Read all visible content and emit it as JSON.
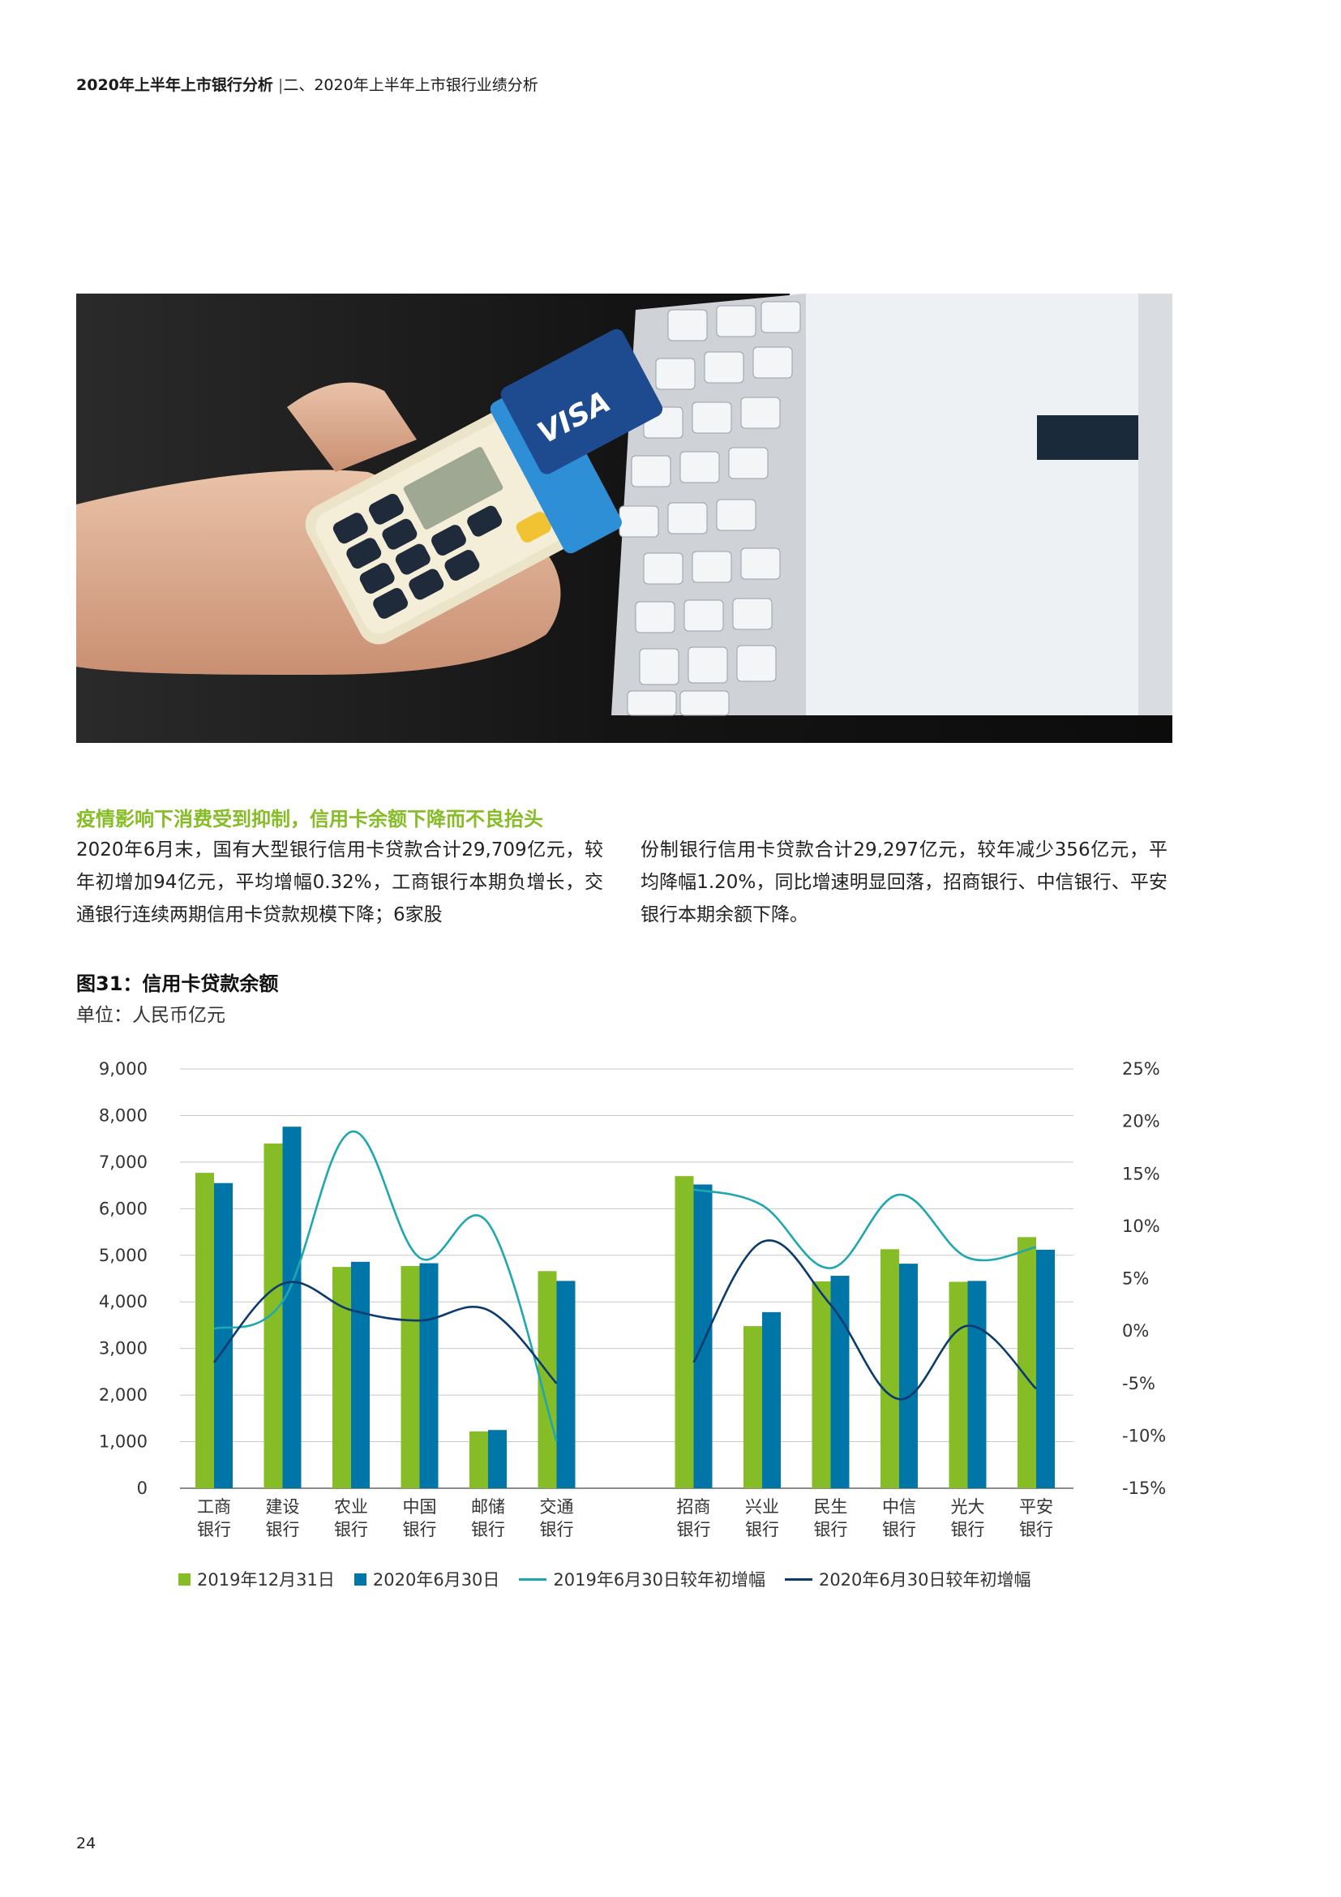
{
  "header": {
    "bold": "2020年上半年上市银行分析",
    "sep": "|",
    "rest": "二、2020年上半年上市银行业绩分析"
  },
  "section_title": "疫情影响下消费受到抑制，信用卡余额下降而不良抬头",
  "paragraph": {
    "left": "2020年6月末，国有大型银行信用卡贷款合计29,709亿元，较年初增加94亿元，平均增幅0.32%，工商银行本期负增长，交通银行连续两期信用卡贷款规模下降；6家股",
    "right": "份制银行信用卡贷款合计29,297亿元，较年减少356亿元，平均降幅1.20%，同比增速明显回落，招商银行、中信银行、平安银行本期余额下降。"
  },
  "figure": {
    "title": "图31：信用卡贷款余额",
    "unit": "单位：人民币亿元"
  },
  "colors": {
    "green": "#86bc25",
    "blue": "#0076a8",
    "teal": "#1fa7b0",
    "navy": "#0b3a6e",
    "grid": "#c8c8c8"
  },
  "chart_data": {
    "type": "bar",
    "categories": [
      "工商\n银行",
      "建设\n银行",
      "农业\n银行",
      "中国\n银行",
      "邮储\n银行",
      "交通\n银行",
      "招商\n银行",
      "兴业\n银行",
      "民生\n银行",
      "中信\n银行",
      "光大\n银行",
      "平安\n银行"
    ],
    "series": [
      {
        "name": "2019年12月31日",
        "type": "bar",
        "axis": "left",
        "values": [
          6770,
          7400,
          4750,
          4770,
          1220,
          4660,
          6700,
          3480,
          4440,
          5130,
          4430,
          5390
        ]
      },
      {
        "name": "2020年6月30日",
        "type": "bar",
        "axis": "left",
        "values": [
          6550,
          7760,
          4860,
          4830,
          1250,
          4450,
          6520,
          3780,
          4560,
          4820,
          4450,
          5120
        ]
      },
      {
        "name": "2019年6月30日较年初增幅",
        "type": "line",
        "axis": "right",
        "values": [
          0.2,
          2.8,
          19.0,
          7.0,
          10.3,
          -10.5,
          13.5,
          12.0,
          6.0,
          13.0,
          7.0,
          8.0
        ]
      },
      {
        "name": "2020年6月30日较年初增幅",
        "type": "line",
        "axis": "right",
        "values": [
          -3.0,
          4.5,
          2.0,
          1.0,
          2.0,
          -5.0,
          -3.0,
          8.5,
          2.5,
          -6.5,
          0.5,
          -5.5
        ]
      }
    ],
    "left_axis": {
      "ylim": [
        0,
        9000
      ],
      "ticks": [
        "0",
        "1,000",
        "2,000",
        "3,000",
        "4,000",
        "5,000",
        "6,000",
        "7,000",
        "8,000",
        "9,000"
      ]
    },
    "right_axis": {
      "ylim": [
        -15,
        25
      ],
      "ticks": [
        "-15%",
        "-10%",
        "-5%",
        "0%",
        "5%",
        "10%",
        "15%",
        "20%",
        "25%"
      ]
    },
    "grid": true,
    "legend_position": "bottom"
  },
  "page_number": "24"
}
